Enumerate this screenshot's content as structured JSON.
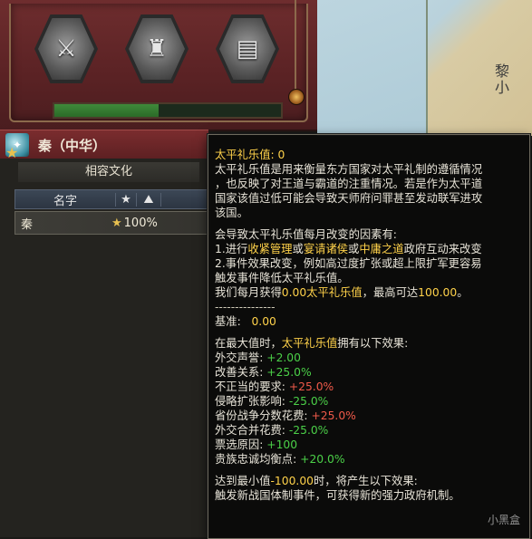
{
  "panel": {
    "country_name": "秦（中华）",
    "culture_title": "相容文化",
    "table": {
      "col_name": "名字",
      "col_star_icon": "star-icon",
      "col_chart_icon": "chart-icon",
      "rows": [
        {
          "name": "秦",
          "percent": "100%"
        }
      ]
    },
    "progress_fraction": 0.46,
    "icons": [
      "army-icon",
      "ancestor-statue-icon",
      "scroll-document-icon"
    ]
  },
  "map": {
    "label": "黎小"
  },
  "tooltip": {
    "title": "太平礼乐值: 0",
    "desc": [
      "太平礼乐值是用来衡量东方国家对太平礼制的遵循情况",
      "，也反映了对王道与霸道的注重情况。若是作为太平道",
      "国家该值过低可能会导致天师府问罪甚至发动联军进攻",
      "该国。"
    ],
    "factors_header": "会导致太平礼乐值每月改变的因素有:",
    "factor1": {
      "a": "1.进行",
      "b": "收紧管理",
      "c": "或",
      "d": "宴请诸侯",
      "e": "或",
      "f": "中庸之道",
      "g": "政府互动来改变"
    },
    "factor2": [
      "2.事件效果改变，例如高过度扩张或超上限扩军更容易",
      "触发事件降低太平礼乐值。"
    ],
    "monthly": {
      "a": "我们每月获得",
      "b": "0.00太平礼乐值",
      "c": "，最高可达",
      "d": "100.00",
      "e": "。"
    },
    "separator": "---------------",
    "base": {
      "label": "基准:",
      "value": "0.00"
    },
    "max_header": {
      "a": "在最大值时，",
      "b": "太平礼乐值",
      "c": "拥有以下效果:"
    },
    "effects": [
      {
        "label": "外交声誉:",
        "value": "+2.00",
        "color": "green"
      },
      {
        "label": "改善关系:",
        "value": "+25.0%",
        "color": "green"
      },
      {
        "label": "不正当的要求:",
        "value": "+25.0%",
        "color": "red"
      },
      {
        "label": "侵略扩张影响:",
        "value": "-25.0%",
        "color": "green"
      },
      {
        "label": "省份战争分数花费:",
        "value": "+25.0%",
        "color": "red"
      },
      {
        "label": "外交合并花费:",
        "value": "-25.0%",
        "color": "green"
      },
      {
        "label": "票选原因:",
        "value": "+100",
        "color": "green"
      },
      {
        "label": "贵族忠诚均衡点:",
        "value": "+20.0%",
        "color": "green"
      }
    ],
    "min_header": {
      "a": "达到最小值",
      "b": "-100.00",
      "c": "时，将产生以下效果:"
    },
    "min_effect": "触发新战国体制事件，可获得新的强力政府机制。",
    "watermark": "小黑盒"
  }
}
